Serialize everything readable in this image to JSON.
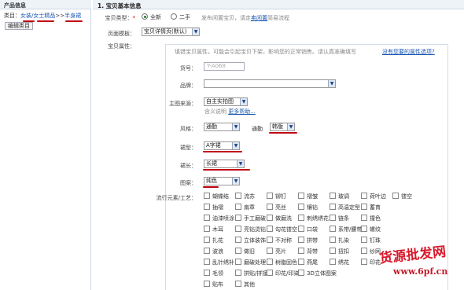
{
  "left": {
    "header": "产品信息",
    "category_prefix": "类目：",
    "category_path": [
      "女装/女士精品",
      "半身裙"
    ],
    "category_sep": ">>",
    "edit_button": "编辑类目"
  },
  "right": {
    "header": "1. 宝贝基本信息",
    "item_type": {
      "label": "宝贝类型：",
      "req": "*",
      "options": [
        "全新",
        "二手"
      ],
      "selected": "全新",
      "hint": "发布闲置宝贝，请走",
      "hint_link": "卖闲置",
      "hint_tail": "简易流程"
    },
    "template": {
      "label": "页面模板：",
      "value": "宝贝详情页(默认)"
    },
    "attrs": {
      "label": "宝贝属性：",
      "hint": "填错宝贝属性，可能会引起宝贝下架，影响您的正常销售。请认真准确填写",
      "missing_link": "没有您要的属性选项?"
    },
    "item_no": {
      "label": "货号：",
      "value": "Y-A068"
    },
    "brand": {
      "label": "品牌：",
      "value": ""
    },
    "photo_source": {
      "label": "主图来源：",
      "value": "自主实拍图",
      "hint": "含义说明",
      "hint_link": "更多帮助..."
    },
    "style": {
      "label": "风格：",
      "value1": "通勤",
      "label2": "通勤",
      "value2": "韩版"
    },
    "cut": {
      "label": "裙型：",
      "value": "A字裙"
    },
    "length": {
      "label": "裙长：",
      "value": "长裙"
    },
    "pattern": {
      "label": "图案：",
      "value": "纯色"
    },
    "trends": {
      "label": "流行元素/工艺：",
      "rows": [
        [
          "蝴蝶结",
          "流苏",
          "铆钉",
          "褶皱",
          "玻调",
          "荷叶边",
          "镂空"
        ],
        [
          "抽褶",
          "扇章",
          "亮丝",
          "镶钻",
          "高温定型",
          "蓄育"
        ],
        [
          "油漆喷涂",
          "手工磨破",
          "做磨洗",
          "刺绣绣花",
          "链条",
          "撞色"
        ],
        [
          "木耳",
          "亮钻烫钻",
          "勾花镂空",
          "口袋",
          "系带/腰带",
          "螺纹"
        ],
        [
          "扎花",
          "立体装饰",
          "不对称",
          "拼带",
          "扎染",
          "钉珠"
        ],
        [
          "波浪",
          "做旧",
          "亮片",
          "背带",
          "扭扣",
          "纱网"
        ],
        [
          "乱针绣补",
          "磨破处理",
          "树脂固色",
          "燕尾",
          "绣花",
          "印花"
        ],
        [
          "毛领",
          "拼贴/拼接",
          "印花/印染",
          "3D立体图案"
        ],
        [
          "贴布",
          "其他"
        ]
      ]
    }
  },
  "watermark": {
    "line1": "货源批发网",
    "line2": "www.6pf.cn"
  },
  "colors": {
    "accent_red": "#c00010",
    "link_blue": "#1a56b0",
    "header_bg": "#eef3f8"
  }
}
